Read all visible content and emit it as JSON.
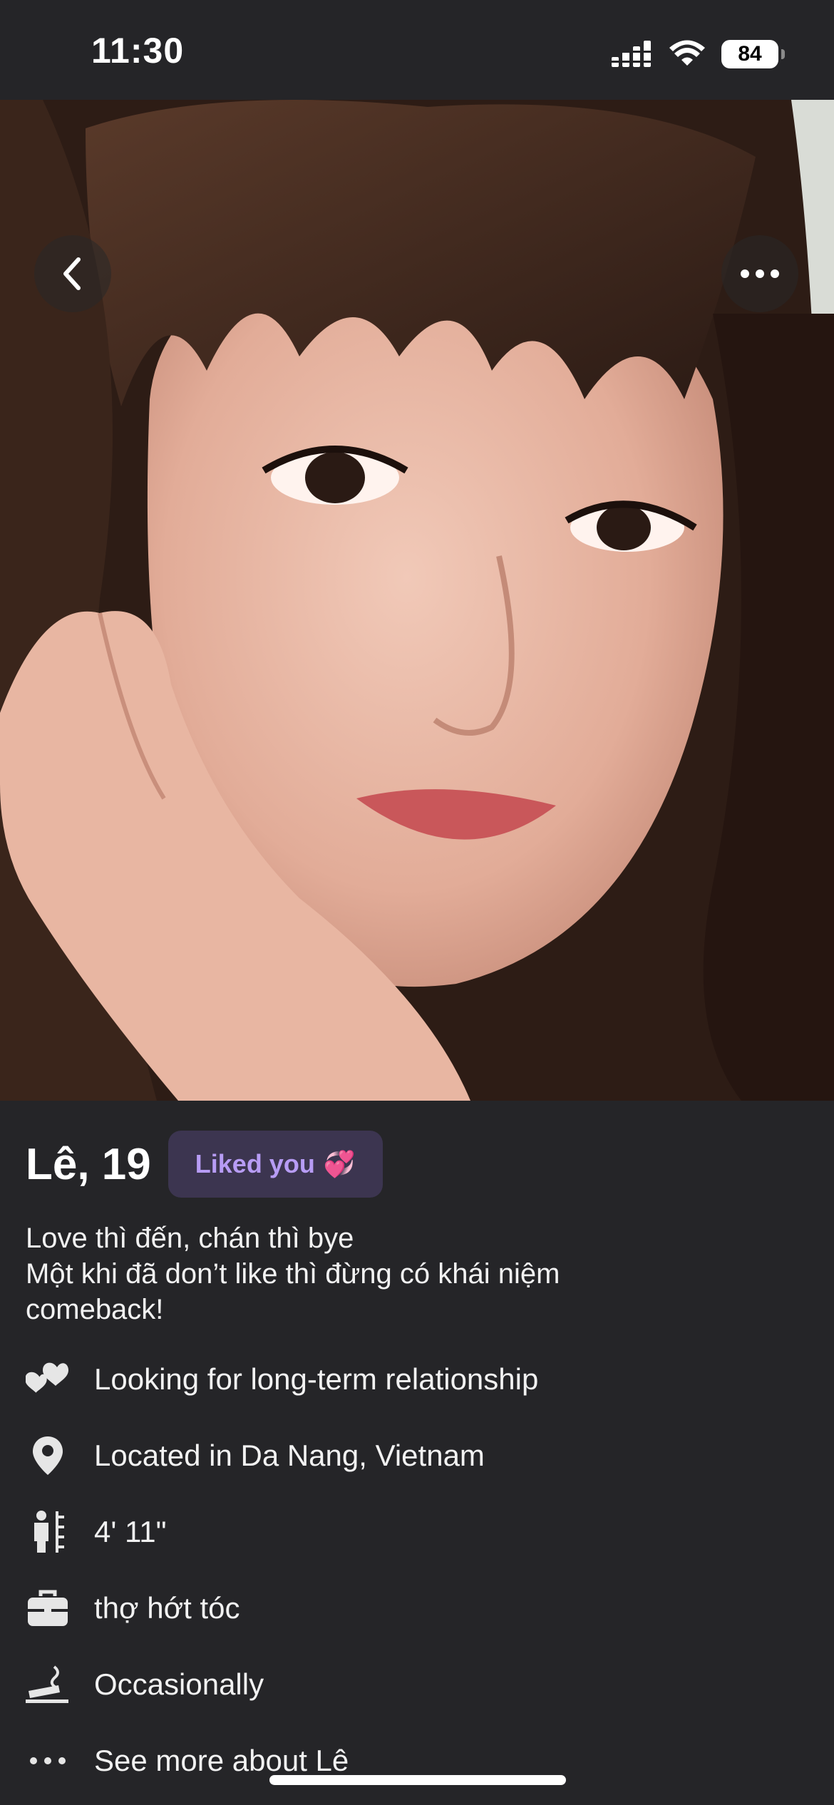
{
  "status": {
    "time": "11:30",
    "battery": "84"
  },
  "profile": {
    "name_age": "Lê, 19",
    "liked_badge": "Liked you",
    "liked_emoji": "💞",
    "bio": [
      "Love thì đến, chán thì bye",
      "Một khi đã don’t like thì đừng có khái niệm",
      "comeback!"
    ],
    "details": [
      {
        "icon": "hearts-icon",
        "label": "Looking for long-term relationship"
      },
      {
        "icon": "location-pin-icon",
        "label": "Located in Da Nang, Vietnam"
      },
      {
        "icon": "height-icon",
        "label": "4' 11\""
      },
      {
        "icon": "briefcase-icon",
        "label": "thợ hớt tóc"
      },
      {
        "icon": "smoking-icon",
        "label": "Occasionally"
      },
      {
        "icon": "more-dots-icon",
        "label": "See more about Lê"
      }
    ]
  },
  "colors": {
    "background": "#252528",
    "badge_bg": "#3c3550",
    "badge_text": "#b79cf5"
  }
}
